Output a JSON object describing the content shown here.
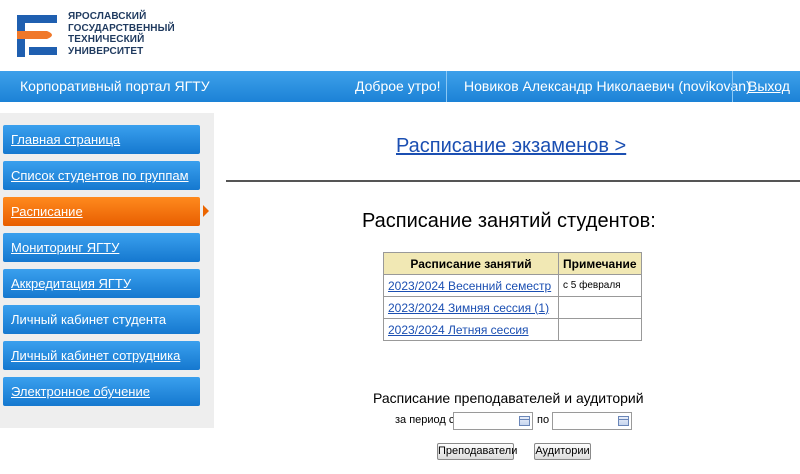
{
  "logo": {
    "lines": [
      "ЯРОСЛАВСКИЙ",
      "ГОСУДАРСТВЕННЫЙ",
      "ТЕХНИЧЕСКИЙ",
      "УНИВЕРСИТЕТ"
    ],
    "colors": {
      "blue": "#1f5fb0",
      "orange": "#f0782a"
    }
  },
  "topbar": {
    "portal_title": "Корпоративный портал ЯГТУ",
    "greeting": "Доброе утро!",
    "user": "Новиков Александр Николаевич (novikovan)",
    "logout": "Выход"
  },
  "sidebar": {
    "items": [
      {
        "label": "Главная страница",
        "active": false
      },
      {
        "label": "Список студентов по группам",
        "active": false
      },
      {
        "label": "Расписание",
        "active": true
      },
      {
        "label": "Мониторинг ЯГТУ",
        "active": false
      },
      {
        "label": "Аккредитация ЯГТУ",
        "active": false
      },
      {
        "label": "Личный кабинет студента",
        "active": false
      },
      {
        "label": "Личный кабинет сотрудника",
        "active": false
      },
      {
        "label": "Электронное обучение",
        "active": false
      }
    ]
  },
  "main": {
    "exam_link": "Расписание экзаменов >",
    "title": "Расписание занятий студентов:",
    "table": {
      "headers": [
        "Расписание занятий",
        "Примечание"
      ],
      "rows": [
        {
          "schedule": "2023/2024 Весенний семестр",
          "note": "с 5 февраля"
        },
        {
          "schedule": "2023/2024 Зимняя сессия (1)",
          "note": ""
        },
        {
          "schedule": "2023/2024 Летняя сессия",
          "note": ""
        }
      ]
    },
    "teachers_title": "Расписание преподавателей и аудиторий",
    "period_from_label": "за период с",
    "period_to_label": "по",
    "teachers_button": "Преподаватели",
    "rooms_button": "Аудитории"
  },
  "colors": {
    "topbar": "#2b8fde",
    "nav": "#1a7fd4",
    "nav_active": "#ee6c0a",
    "table_header": "#f1e8b4",
    "link": "#1b4fb2"
  }
}
